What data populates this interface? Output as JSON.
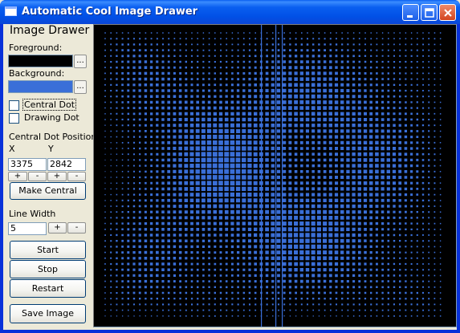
{
  "window": {
    "title": "Automatic Cool Image Drawer",
    "icons": [
      "app-icon",
      "minimize-icon",
      "maximize-icon",
      "close-icon"
    ]
  },
  "panel": {
    "heading": "Image Drawer",
    "foreground": {
      "label": "Foreground:",
      "color": "#000000",
      "browse_label": "..."
    },
    "background": {
      "label": "Background:",
      "color": "#3a6fd8",
      "browse_label": "..."
    },
    "central_dot": {
      "label": "Central Dot",
      "checked": false
    },
    "drawing_dot": {
      "label": "Drawing Dot",
      "checked": false
    },
    "central_dot_position": {
      "label": "Central Dot Position:",
      "x_label": "X",
      "y_label": "Y",
      "x_value": "3375",
      "y_value": "2842",
      "plus": "+",
      "minus": "-"
    },
    "make_central_label": "Make Central",
    "line_width": {
      "label": "Line Width",
      "value": "5",
      "plus": "+",
      "minus": "-"
    },
    "start_label": "Start",
    "stop_label": "Stop",
    "restart_label": "Restart",
    "save_image_label": "Save Image"
  },
  "canvas": {
    "background": "#000000",
    "pattern_color": "#3a6fd8"
  }
}
